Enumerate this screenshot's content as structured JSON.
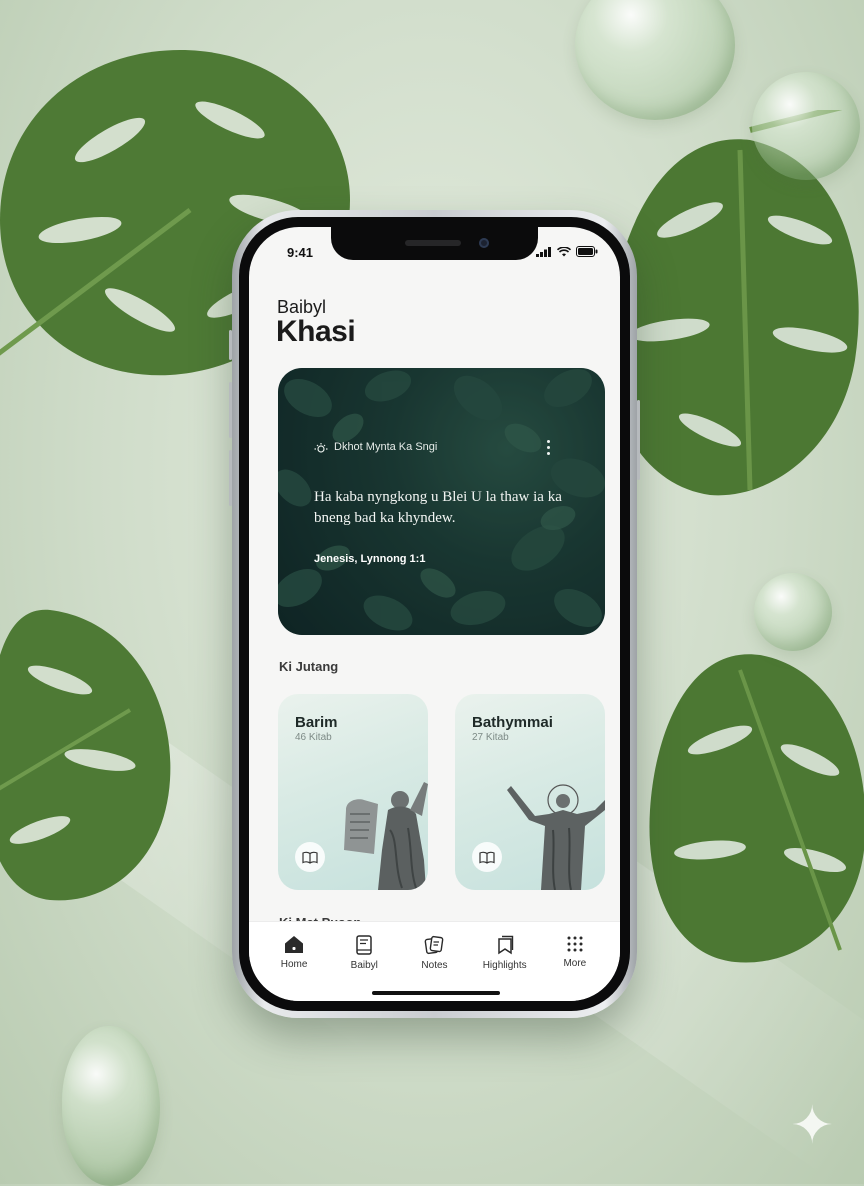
{
  "status": {
    "time": "9:41"
  },
  "brand": {
    "subtitle": "Baibyl",
    "title": "Khasi"
  },
  "verse_card": {
    "label": "Dkhot Mynta Ka Sngi",
    "text": "Ha kaba nyngkong u Blei U la thaw ia ka bneng bad ka khyndew.",
    "reference": "Jenesis, Lynnong 1:1"
  },
  "sections": {
    "ki_jutang": "Ki Jutang",
    "ki_mat_puson": "Ki Mat Puson"
  },
  "books": [
    {
      "title": "Barim",
      "count": "46 Kitab"
    },
    {
      "title": "Bathymmai",
      "count": "27 Kitab"
    }
  ],
  "tabs": [
    {
      "label": "Home",
      "icon": "home-icon"
    },
    {
      "label": "Baibyl",
      "icon": "bible-icon"
    },
    {
      "label": "Notes",
      "icon": "notes-icon"
    },
    {
      "label": "Highlights",
      "icon": "highlights-icon"
    },
    {
      "label": "More",
      "icon": "grid-icon"
    }
  ],
  "colors": {
    "accent": "#1d3d36",
    "leaf": "#4e7a35",
    "background": "#d6e2d1"
  }
}
